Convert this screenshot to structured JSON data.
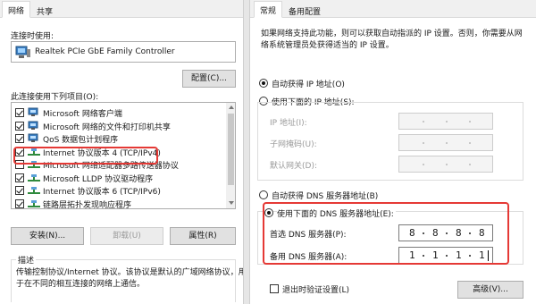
{
  "left": {
    "tabs": [
      "网络",
      "共享"
    ],
    "connect_using_label": "连接时使用:",
    "adapter_name": "Realtek PCIe GbE Family Controller",
    "configure_button": "配置(C)...",
    "items_label": "此连接使用下列项目(O):",
    "items": [
      {
        "label": "Microsoft 网络客户端",
        "checked": true,
        "icon": "network-client-icon"
      },
      {
        "label": "Microsoft 网络的文件和打印机共享",
        "checked": true,
        "icon": "file-printer-sharing-icon"
      },
      {
        "label": "QoS 数据包计划程序",
        "checked": true,
        "icon": "qos-scheduler-icon"
      },
      {
        "label": "Internet 协议版本 4 (TCP/IPv4)",
        "checked": true,
        "icon": "protocol-icon"
      },
      {
        "label": "Microsoft 网络适配器多路传送器协议",
        "checked": false,
        "icon": "protocol-icon"
      },
      {
        "label": "Microsoft LLDP 协议驱动程序",
        "checked": true,
        "icon": "protocol-icon"
      },
      {
        "label": "Internet 协议版本 6 (TCP/IPv6)",
        "checked": true,
        "icon": "protocol-icon"
      },
      {
        "label": "链路层拓扑发现响应程序",
        "checked": true,
        "icon": "protocol-icon"
      }
    ],
    "install_button": "安装(N)...",
    "uninstall_button": "卸载(U)",
    "properties_button": "属性(R)",
    "description_label": "描述",
    "description_line1": "传输控制协议/Internet 协议。该协议是默认的广域网络协议，用",
    "description_line2": "于在不同的相互连接的网络上通信。"
  },
  "right": {
    "tabs": [
      "常规",
      "备用配置"
    ],
    "intro_line1": "如果网络支持此功能，则可以获取自动指派的 IP 设置。否则，你需要从网",
    "intro_line2": "络系统管理员处获得适当的 IP 设置。",
    "auto_ip_label": "自动获得 IP 地址(O)",
    "manual_ip_label": "使用下面的 IP 地址(S):",
    "ip_address_label": "IP 地址(I):",
    "subnet_label": "子网掩码(U):",
    "gateway_label": "默认网关(D):",
    "auto_dns_label": "自动获得 DNS 服务器地址(B)",
    "manual_dns_label": "使用下面的 DNS 服务器地址(E):",
    "preferred_dns_label": "首选 DNS 服务器(P):",
    "preferred_dns": [
      "8",
      "8",
      "8",
      "8"
    ],
    "alternate_dns_label": "备用 DNS 服务器(A):",
    "alternate_dns": [
      "1",
      "1",
      "1",
      "1"
    ],
    "validate_label": "退出时验证设置(L)",
    "advanced_button": "高级(V)..."
  },
  "colors": {
    "highlight": "#e53935",
    "focus": "#2a6cd8"
  }
}
